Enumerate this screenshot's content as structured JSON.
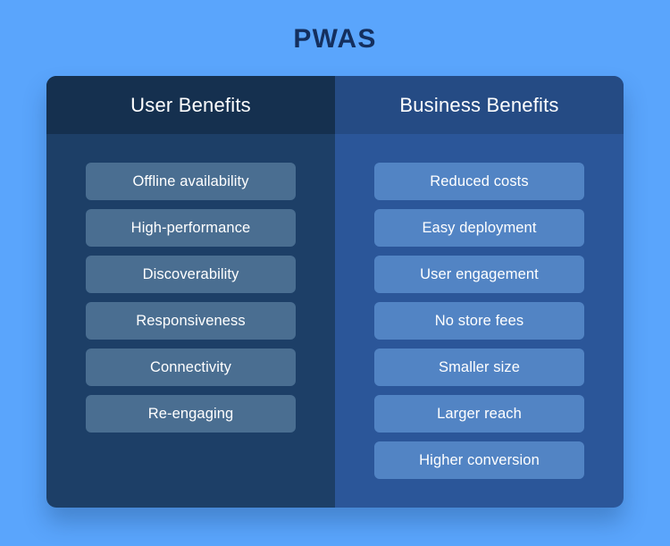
{
  "page": {
    "title": "PWAS",
    "background_color": "#5AA5FC",
    "title_color": "#142F5E"
  },
  "card": {
    "columns": [
      {
        "id": "user-benefits",
        "header": "User Benefits",
        "header_color": "#15304F",
        "body_color": "#1D3F67",
        "pill_color": "#4A6E91",
        "items": [
          "Offline availability",
          "High-performance",
          "Discoverability",
          "Responsiveness",
          "Connectivity",
          "Re-engaging"
        ]
      },
      {
        "id": "business-benefits",
        "header": "Business Benefits",
        "header_color": "#254B84",
        "body_color": "#2B5699",
        "pill_color": "#5284C4",
        "items": [
          "Reduced costs",
          "Easy deployment",
          "User engagement",
          "No store fees",
          "Smaller size",
          "Larger reach",
          "Higher conversion"
        ]
      }
    ]
  }
}
